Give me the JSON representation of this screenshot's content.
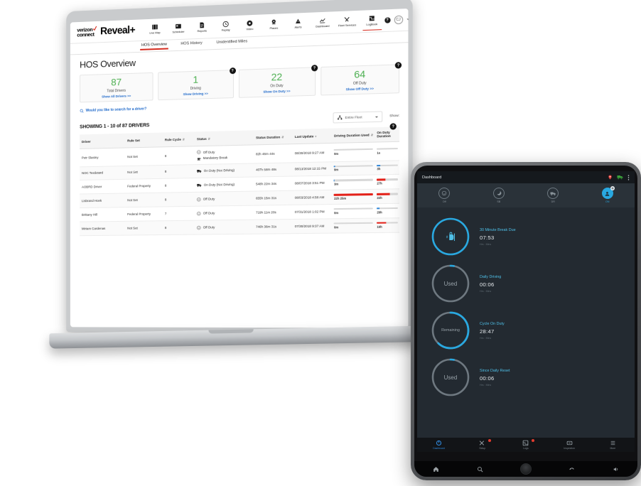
{
  "laptop": {
    "topbar": {
      "logo_line1": "verizon",
      "logo_line2": "connect",
      "brand": "Reveal+",
      "nav_items": [
        {
          "label": "Live Map",
          "icon": "map-icon"
        },
        {
          "label": "Scheduler",
          "icon": "calendar-icon"
        },
        {
          "label": "Reports",
          "icon": "document-icon"
        },
        {
          "label": "Replay",
          "icon": "replay-icon"
        },
        {
          "label": "Video",
          "icon": "video-icon"
        },
        {
          "label": "Places",
          "icon": "pin-icon"
        },
        {
          "label": "Alerts",
          "icon": "warning-icon"
        },
        {
          "label": "Dashboard",
          "icon": "chart-icon"
        },
        {
          "label": "Fleet Services",
          "icon": "tools-icon"
        },
        {
          "label": "LogBook",
          "icon": "logbook-icon"
        }
      ],
      "active_nav": "LogBook",
      "help_label": "?",
      "avatar_initials": "CJ"
    },
    "subtabs": [
      {
        "label": "HOS Overview",
        "active": true
      },
      {
        "label": "HOS History",
        "active": false
      },
      {
        "label": "Unidentified Miles",
        "active": false
      }
    ],
    "page_title": "HOS Overview",
    "stat_cards": [
      {
        "value": "87",
        "label": "Total Drivers",
        "link": "Show All Drivers >>",
        "badge": ""
      },
      {
        "value": "1",
        "label": "Driving",
        "link": "Show Driving >>",
        "badge": "?"
      },
      {
        "value": "22",
        "label": "On Duty",
        "link": "Show On Duty >>",
        "badge": "?"
      },
      {
        "value": "64",
        "label": "Off Duty",
        "link": "Show Off Duty >>",
        "badge": "?"
      }
    ],
    "search_prompt": "Would you like to search for a driver?",
    "showing_text": "SHOWING 1 - 10 of 87 DRIVERS",
    "fleet_selector": "Entire Fleet",
    "show_label": "Show:",
    "table": {
      "headers": [
        {
          "label": "Driver",
          "sortable": false
        },
        {
          "label": "Rule Set",
          "sortable": false
        },
        {
          "label": "Rule Cycle",
          "sortable": true
        },
        {
          "label": "Status",
          "sortable": true
        },
        {
          "label": "Status Duration",
          "sortable": true
        },
        {
          "label": "Last Update",
          "sortable": true
        },
        {
          "label": "Driving Duration Used",
          "sortable": true
        },
        {
          "label": "On Duty Duration",
          "sortable": true
        }
      ],
      "header_badge": "?",
      "rows": [
        {
          "driver": "Petr Slastny",
          "rule_set": "Not Set",
          "rule_cycle": "8",
          "status": "Off Duty",
          "status_icon": "off-duty-icon",
          "status2": "Mandatory Break",
          "status2_icon": "coffee-icon",
          "status_duration": "82h 46m 44s",
          "last_update": "08/30/2018 9:27 AM",
          "driving_used_value": "0m",
          "driving_used_pct": 0,
          "driving_used_color": "#d8d8d8",
          "onduty_value": "1s",
          "onduty_pct": 0,
          "onduty_color": "#d8d8d8"
        },
        {
          "driver": "NOC Testboard",
          "rule_set": "Not Set",
          "rule_cycle": "8",
          "status": "On Duty (Not Driving)",
          "status_icon": "truck-icon",
          "status2": "",
          "status2_icon": "",
          "status_duration": "407h 58m 48s",
          "last_update": "08/13/2018 12:15 PM",
          "driving_used_value": "9m",
          "driving_used_pct": 2,
          "driving_used_color": "#2f86d8",
          "onduty_value": "3h",
          "onduty_pct": 18,
          "onduty_color": "#2f86d8"
        },
        {
          "driver": "AOBRD Driver",
          "rule_set": "Federal Property",
          "rule_cycle": "8",
          "status": "On Duty (Not Driving)",
          "status_icon": "truck-icon",
          "status2": "",
          "status2_icon": "",
          "status_duration": "548h 22m 34s",
          "last_update": "08/07/2018 3:51 PM",
          "driving_used_value": "3m",
          "driving_used_pct": 1,
          "driving_used_color": "#2f86d8",
          "onduty_value": "27h",
          "onduty_pct": 40,
          "onduty_color": "#e32119"
        },
        {
          "driver": "Lisbrand Hoek",
          "rule_set": "Not Set",
          "rule_cycle": "8",
          "status": "Off Duty",
          "status_icon": "off-duty-icon",
          "status2": "",
          "status2_icon": "",
          "status_duration": "655h 15m 31s",
          "last_update": "08/03/2018 4:58 AM",
          "driving_used_value": "22h 25m",
          "driving_used_pct": 100,
          "driving_used_color": "#e32119",
          "onduty_value": "22h",
          "onduty_pct": 60,
          "onduty_color": "#e32119"
        },
        {
          "driver": "Brittany Hill",
          "rule_set": "Federal Property",
          "rule_cycle": "7",
          "status": "Off Duty",
          "status_icon": "off-duty-icon",
          "status2": "",
          "status2_icon": "",
          "status_duration": "719h 11m 20s",
          "last_update": "07/31/2018 1:02 PM",
          "driving_used_value": "0m",
          "driving_used_pct": 0,
          "driving_used_color": "#d8d8d8",
          "onduty_value": "29h",
          "onduty_pct": 12,
          "onduty_color": "#2f86d8"
        },
        {
          "driver": "Miriam Cardenas",
          "rule_set": "Not Set",
          "rule_cycle": "8",
          "status": "Off Duty",
          "status_icon": "off-duty-icon",
          "status2": "",
          "status2_icon": "",
          "status_duration": "746h 36m 31s",
          "last_update": "07/30/2018 9:37 AM",
          "driving_used_value": "0m",
          "driving_used_pct": 0,
          "driving_used_color": "#d8d8d8",
          "onduty_value": "19h",
          "onduty_pct": 45,
          "onduty_color": "#e32119"
        }
      ]
    }
  },
  "tablet": {
    "header_title": "Dashboard",
    "header_icons": [
      "pin-icon",
      "truck-icon",
      "menu-icon"
    ],
    "status_row": [
      {
        "label": "Off",
        "icon": "off-duty-icon",
        "active": false
      },
      {
        "label": "SB",
        "icon": "sleeper-berth-icon",
        "active": false
      },
      {
        "label": "DR",
        "icon": "truck-icon",
        "active": false
      },
      {
        "label": "ON",
        "icon": "on-duty-icon",
        "active": true
      }
    ],
    "gauges": [
      {
        "name": "30 Minute Break Due",
        "value": "07:53",
        "sub": "Hrs : Mins",
        "center_text": "",
        "center_icon": "coffee-icon",
        "percent": 100,
        "color": "#29a8e0"
      },
      {
        "name": "Daily Driving",
        "value": "00:06",
        "sub": "Hrs : Mins",
        "center_text": "Used",
        "center_icon": "",
        "percent": 3,
        "color": "#29a8e0"
      },
      {
        "name": "Cycle On Duty",
        "value": "28:47",
        "sub": "Hrs : Mins",
        "center_text": "Remaining",
        "center_icon": "",
        "percent": 62,
        "color": "#29a8e0"
      },
      {
        "name": "Since Daily Reset",
        "value": "00:06",
        "sub": "Hrs : Mins",
        "center_text": "Used",
        "center_icon": "",
        "percent": 3,
        "color": "#29a8e0"
      }
    ],
    "tabbar": [
      {
        "label": "Dashboard",
        "icon": "dashboard-icon",
        "active": true,
        "alert": false
      },
      {
        "label": "Setup",
        "icon": "tools-icon",
        "active": false,
        "alert": true
      },
      {
        "label": "Logs",
        "icon": "logbook-icon",
        "active": false,
        "alert": true
      },
      {
        "label": "Inspection",
        "icon": "inspection-icon",
        "active": false,
        "alert": false
      },
      {
        "label": "More",
        "icon": "menu-icon",
        "active": false,
        "alert": false
      }
    ],
    "navbar": [
      "home-icon",
      "search-icon",
      "home-circle-icon",
      "back-icon",
      "volume-icon"
    ]
  }
}
